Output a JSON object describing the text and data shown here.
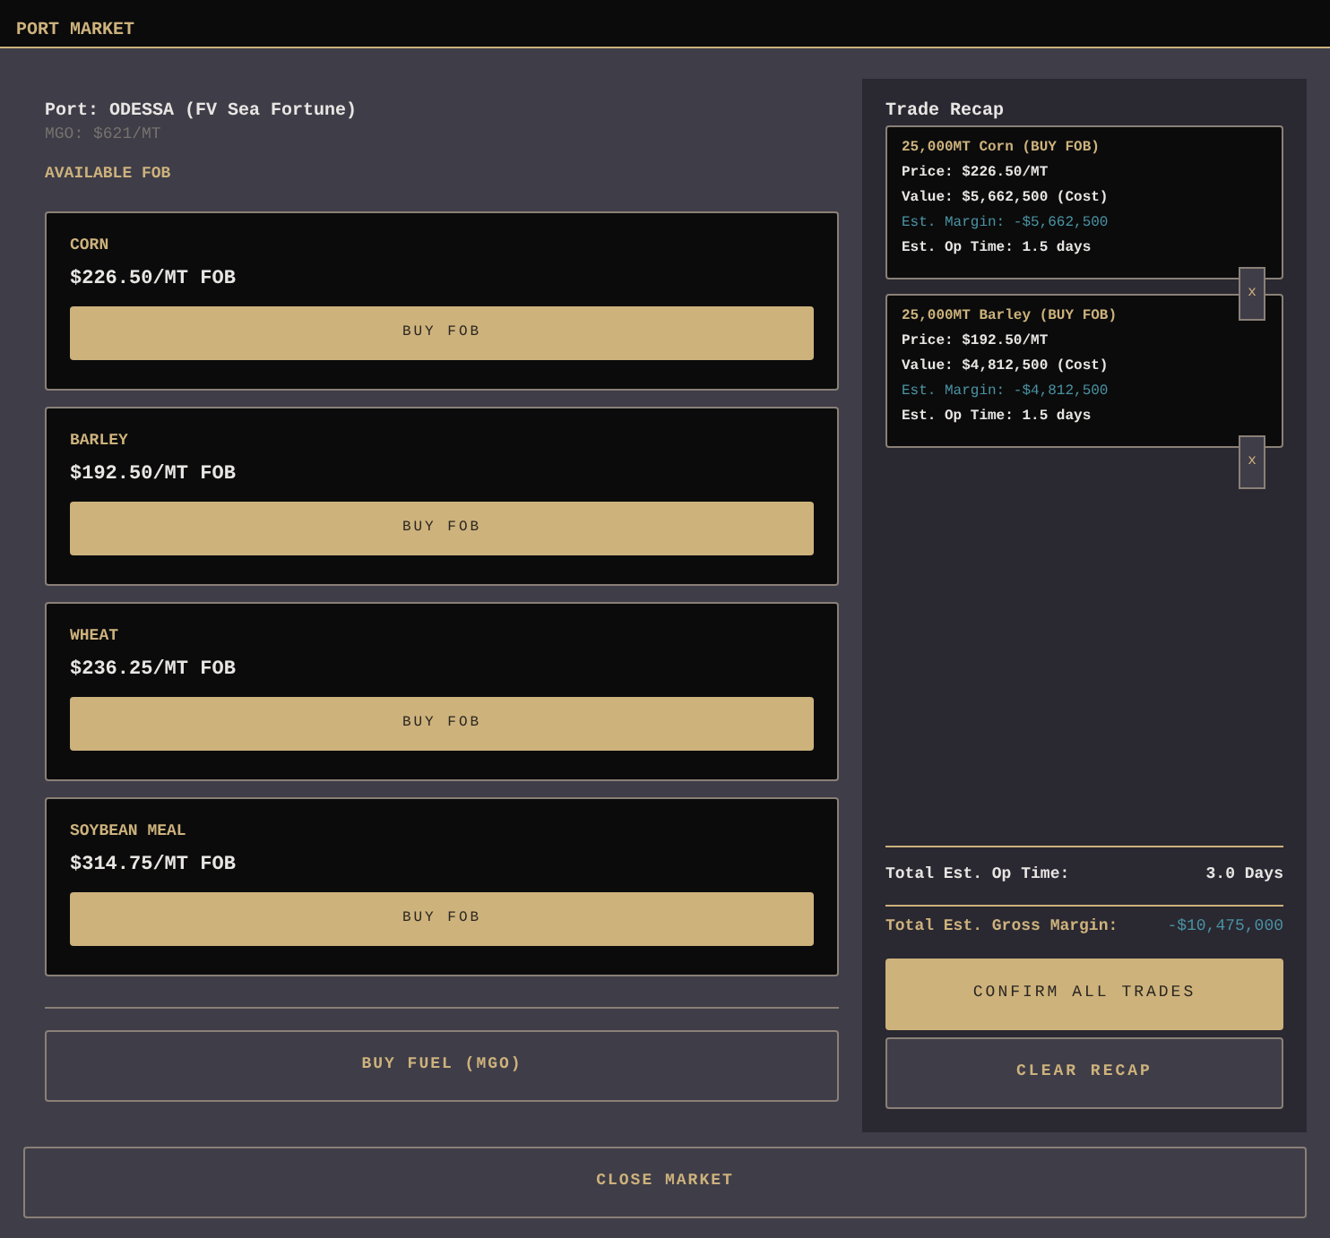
{
  "header": {
    "title": "PORT MARKET"
  },
  "port": {
    "label": "Port: ODESSA (FV Sea Fortune)",
    "mgo": "MGO: $621/MT"
  },
  "section_title": "AVAILABLE FOB",
  "products": [
    {
      "name": "CORN",
      "price": "$226.50/MT FOB",
      "button": "BUY FOB"
    },
    {
      "name": "BARLEY",
      "price": "$192.50/MT FOB",
      "button": "BUY FOB"
    },
    {
      "name": "WHEAT",
      "price": "$236.25/MT FOB",
      "button": "BUY FOB"
    },
    {
      "name": "SOYBEAN MEAL",
      "price": "$314.75/MT FOB",
      "button": "BUY FOB"
    }
  ],
  "fuel_button": "BUY FUEL (MGO)",
  "recap": {
    "title": "Trade Recap",
    "trades": [
      {
        "title": "25,000MT Corn (BUY FOB)",
        "price": "Price: $226.50/MT",
        "value": "Value: $5,662,500 (Cost)",
        "margin": "Est. Margin: -$5,662,500",
        "op_time": "Est. Op Time: 1.5 days",
        "remove": "x"
      },
      {
        "title": "25,000MT Barley (BUY FOB)",
        "price": "Price: $192.50/MT",
        "value": "Value: $4,812,500 (Cost)",
        "margin": "Est. Margin: -$4,812,500",
        "op_time": "Est. Op Time: 1.5 days",
        "remove": "x"
      }
    ],
    "total_time": {
      "label": "Total Est. Op Time:",
      "value": "3.0 Days"
    },
    "total_margin": {
      "label": "Total Est. Gross Margin:",
      "value": "-$10,475,000"
    },
    "confirm": "CONFIRM ALL TRADES",
    "clear": "CLEAR RECAP"
  },
  "close_button": "CLOSE MARKET"
}
